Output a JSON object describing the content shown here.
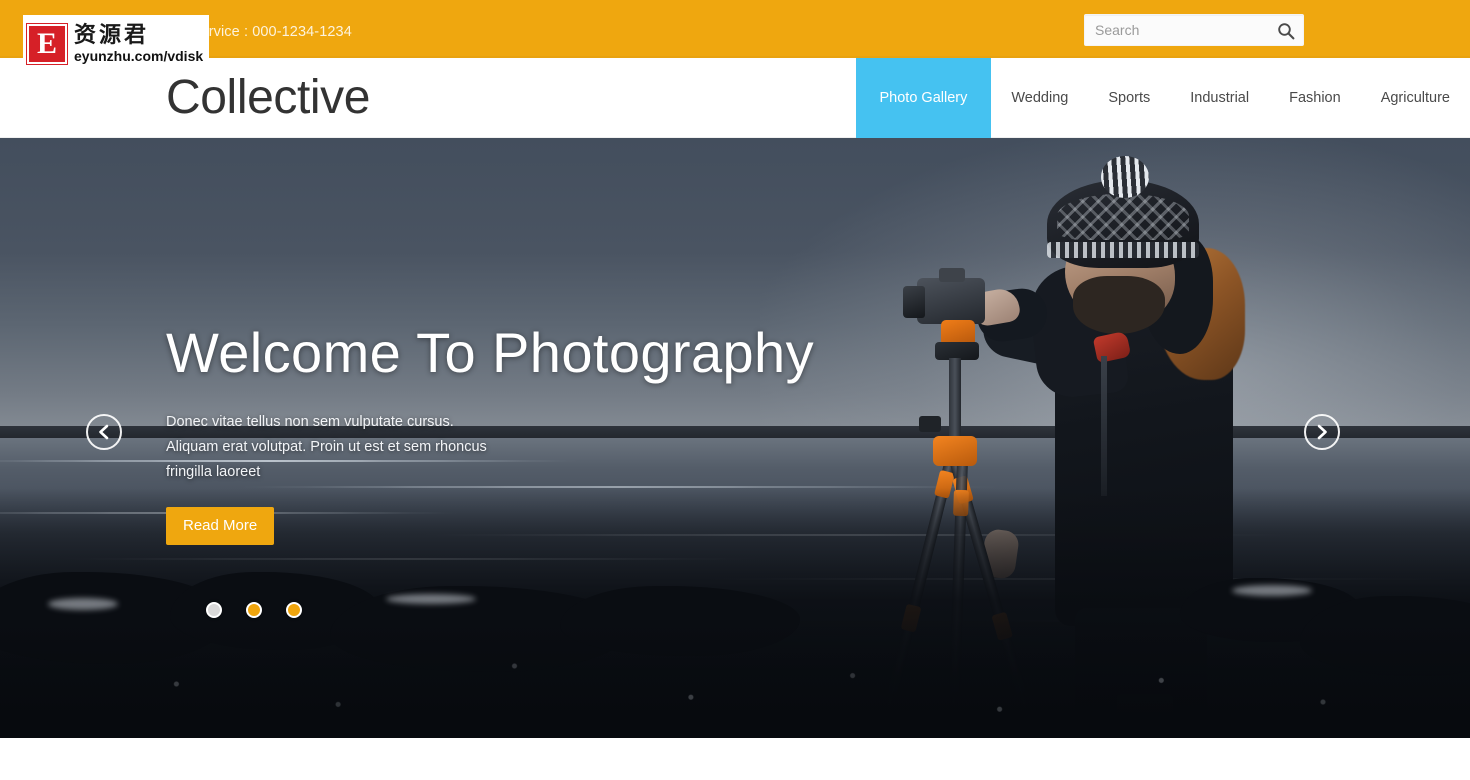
{
  "topbar": {
    "info_text": "Information Service : 000-1234-1234",
    "search": {
      "placeholder": "Search",
      "value": "",
      "icon": "search-icon"
    },
    "background_color": "#efa70f"
  },
  "header": {
    "brand": "Collective",
    "nav": [
      {
        "label": "Photo Gallery",
        "active": true
      },
      {
        "label": "Wedding",
        "active": false
      },
      {
        "label": "Sports",
        "active": false
      },
      {
        "label": "Industrial",
        "active": false
      },
      {
        "label": "Fashion",
        "active": false
      },
      {
        "label": "Agriculture",
        "active": false
      }
    ],
    "active_color": "#45c2f1"
  },
  "hero": {
    "title": "Welcome To Photography",
    "description": "Donec vitae tellus non sem vulputate cursus. Aliquam erat volutpat. Proin ut est et sem rhoncus fringilla laoreet",
    "button_label": "Read More",
    "button_color": "#efa70f",
    "prev_icon": "chevron-left-icon",
    "next_icon": "chevron-right-icon",
    "dots": [
      {
        "state": "active"
      },
      {
        "state": "idle"
      },
      {
        "state": "idle"
      }
    ],
    "image_alt": "photographer-with-camera-on-tripod-at-icy-shore"
  },
  "watermark": {
    "logo_letter": "E",
    "name_cn": "资源君",
    "url": "eyunzhu.com/vdisk",
    "logo_color": "#d62027"
  }
}
